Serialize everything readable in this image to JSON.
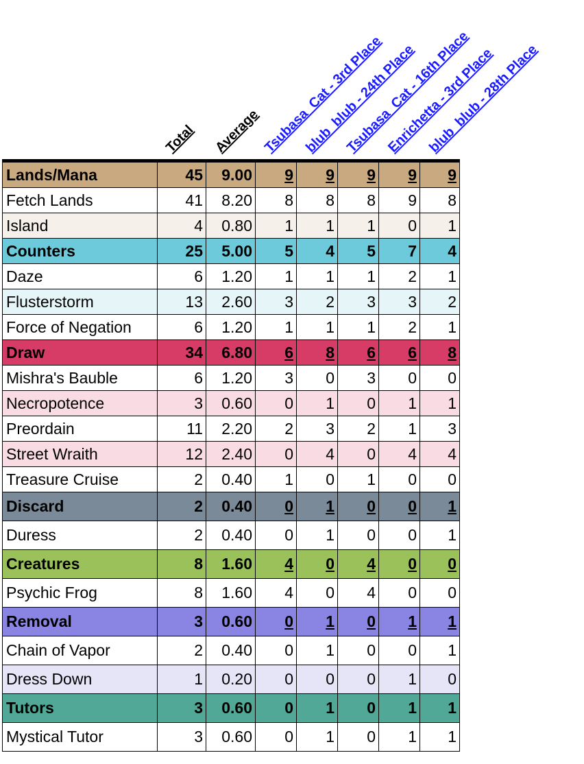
{
  "headers": {
    "stats": [
      "Total",
      "Average"
    ],
    "players": [
      "Tsubasa_Cat - 3rd Place",
      "blub_blub - 24th Place",
      "Tsubasa_Cat - 16th Place",
      "Enrichetta - 3rd Place",
      "blub_blub - 28th Place"
    ]
  },
  "colors": {
    "lands": "#c9a97f",
    "lands_light": "#f5f0ea",
    "counters": "#6ccada",
    "counters_light": "#e6f5f8",
    "draw": "#d63c66",
    "draw_light": "#f8dbe3",
    "discard": "#7a8a99",
    "discard_light": "#e4e8ec",
    "creatures": "#9bc25a",
    "creatures_light": "#eef5e4",
    "removal": "#8a85e2",
    "removal_light": "#e6e5f8",
    "tutors": "#52a896",
    "tutors_light": "#e2f2ee",
    "player_header": "#1a1aff"
  },
  "rows": [
    {
      "kind": "cat",
      "color": "lands",
      "name": "Lands/Mana",
      "total": "45",
      "avg": "9.00",
      "vals": [
        "9",
        "9",
        "9",
        "9",
        "9"
      ],
      "underline": true
    },
    {
      "kind": "card",
      "shade": false,
      "name": "Fetch Lands",
      "total": "41",
      "avg": "8.20",
      "vals": [
        "8",
        "8",
        "8",
        "9",
        "8"
      ]
    },
    {
      "kind": "card",
      "shade": "lands_light",
      "name": "Island",
      "total": "4",
      "avg": "0.80",
      "vals": [
        "1",
        "1",
        "1",
        "0",
        "1"
      ]
    },
    {
      "kind": "cat",
      "color": "counters",
      "name": "Counters",
      "total": "25",
      "avg": "5.00",
      "vals": [
        "5",
        "4",
        "5",
        "7",
        "4"
      ],
      "underline": false
    },
    {
      "kind": "card",
      "shade": false,
      "name": "Daze",
      "total": "6",
      "avg": "1.20",
      "vals": [
        "1",
        "1",
        "1",
        "2",
        "1"
      ]
    },
    {
      "kind": "card",
      "shade": "counters_light",
      "name": "Flusterstorm",
      "total": "13",
      "avg": "2.60",
      "vals": [
        "3",
        "2",
        "3",
        "3",
        "2"
      ]
    },
    {
      "kind": "card",
      "shade": false,
      "name": "Force of Negation",
      "total": "6",
      "avg": "1.20",
      "vals": [
        "1",
        "1",
        "1",
        "2",
        "1"
      ]
    },
    {
      "kind": "cat",
      "color": "draw",
      "name": "Draw",
      "total": "34",
      "avg": "6.80",
      "vals": [
        "6",
        "8",
        "6",
        "6",
        "8"
      ],
      "underline": true
    },
    {
      "kind": "card",
      "shade": false,
      "name": "Mishra's Bauble",
      "total": "6",
      "avg": "1.20",
      "vals": [
        "3",
        "0",
        "3",
        "0",
        "0"
      ]
    },
    {
      "kind": "card",
      "shade": "draw_light",
      "name": "Necropotence",
      "total": "3",
      "avg": "0.60",
      "vals": [
        "0",
        "1",
        "0",
        "1",
        "1"
      ]
    },
    {
      "kind": "card",
      "shade": false,
      "name": "Preordain",
      "total": "11",
      "avg": "2.20",
      "vals": [
        "2",
        "3",
        "2",
        "1",
        "3"
      ]
    },
    {
      "kind": "card",
      "shade": "draw_light",
      "name": "Street Wraith",
      "total": "12",
      "avg": "2.40",
      "vals": [
        "0",
        "4",
        "0",
        "4",
        "4"
      ]
    },
    {
      "kind": "card",
      "shade": false,
      "name": "Treasure Cruise",
      "total": "2",
      "avg": "0.40",
      "vals": [
        "1",
        "0",
        "1",
        "0",
        "0"
      ]
    },
    {
      "kind": "cat",
      "color": "discard",
      "name": "Discard",
      "total": "2",
      "avg": "0.40",
      "vals": [
        "0",
        "1",
        "0",
        "0",
        "1"
      ],
      "underline": true,
      "tall": true
    },
    {
      "kind": "card",
      "shade": false,
      "name": "Duress",
      "total": "2",
      "avg": "0.40",
      "vals": [
        "0",
        "1",
        "0",
        "0",
        "1"
      ],
      "tall": true
    },
    {
      "kind": "cat",
      "color": "creatures",
      "name": "Creatures",
      "total": "8",
      "avg": "1.60",
      "vals": [
        "4",
        "0",
        "4",
        "0",
        "0"
      ],
      "underline": true,
      "tall": true
    },
    {
      "kind": "card",
      "shade": false,
      "name": "Psychic Frog",
      "total": "8",
      "avg": "1.60",
      "vals": [
        "4",
        "0",
        "4",
        "0",
        "0"
      ],
      "tall": true
    },
    {
      "kind": "cat",
      "color": "removal",
      "name": "Removal",
      "total": "3",
      "avg": "0.60",
      "vals": [
        "0",
        "1",
        "0",
        "1",
        "1"
      ],
      "underline": true,
      "tall": true
    },
    {
      "kind": "card",
      "shade": false,
      "name": "Chain of Vapor",
      "total": "2",
      "avg": "0.40",
      "vals": [
        "0",
        "1",
        "0",
        "0",
        "1"
      ],
      "tall": true
    },
    {
      "kind": "card",
      "shade": "removal_light",
      "name": "Dress Down",
      "total": "1",
      "avg": "0.20",
      "vals": [
        "0",
        "0",
        "0",
        "1",
        "0"
      ],
      "tall": true
    },
    {
      "kind": "cat",
      "color": "tutors",
      "name": "Tutors",
      "total": "3",
      "avg": "0.60",
      "vals": [
        "0",
        "1",
        "0",
        "1",
        "1"
      ],
      "underline": false,
      "tall": true
    },
    {
      "kind": "card",
      "shade": false,
      "name": "Mystical Tutor",
      "total": "3",
      "avg": "0.60",
      "vals": [
        "0",
        "1",
        "0",
        "1",
        "1"
      ],
      "tall": true
    }
  ]
}
